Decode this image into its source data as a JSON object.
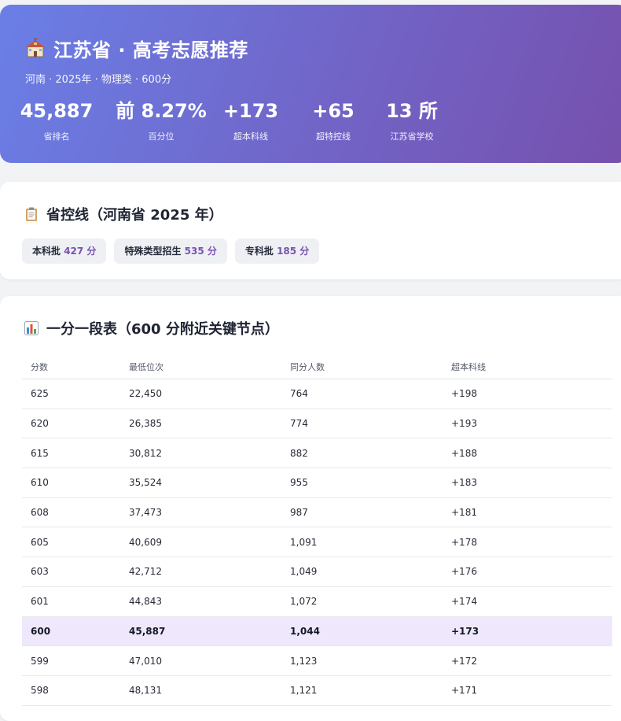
{
  "hero": {
    "title": "江苏省 · 高考志愿推荐",
    "subtitle": "河南 · 2025年 · 物理类 · 600分",
    "stats": [
      {
        "value": "45,887",
        "label": "省排名"
      },
      {
        "value": "前 8.27%",
        "label": "百分位"
      },
      {
        "value": "+173",
        "label": "超本科线"
      },
      {
        "value": "+65",
        "label": "超特控线"
      },
      {
        "value": "13 所",
        "label": "江苏省学校"
      }
    ]
  },
  "control_lines": {
    "title": "省控线（河南省 2025 年）",
    "items": [
      {
        "name": "本科批",
        "score": "427 分"
      },
      {
        "name": "特殊类型招生",
        "score": "535 分"
      },
      {
        "name": "专科批",
        "score": "185 分"
      }
    ]
  },
  "score_table": {
    "title": "一分一段表（600 分附近关键节点）",
    "headers": [
      "分数",
      "最低位次",
      "同分人数",
      "超本科线"
    ],
    "rows": [
      [
        "625",
        "22,450",
        "764",
        "+198"
      ],
      [
        "620",
        "26,385",
        "774",
        "+193"
      ],
      [
        "615",
        "30,812",
        "882",
        "+188"
      ],
      [
        "610",
        "35,524",
        "955",
        "+183"
      ],
      [
        "608",
        "37,473",
        "987",
        "+181"
      ],
      [
        "605",
        "40,609",
        "1,091",
        "+178"
      ],
      [
        "603",
        "42,712",
        "1,049",
        "+176"
      ],
      [
        "601",
        "44,843",
        "1,072",
        "+174"
      ],
      [
        "600",
        "45,887",
        "1,044",
        "+173"
      ],
      [
        "599",
        "47,010",
        "1,123",
        "+172"
      ],
      [
        "598",
        "48,131",
        "1,121",
        "+171"
      ]
    ],
    "highlight_score": "600"
  },
  "colors": {
    "hero_gradient_start": "#6a7fe6",
    "hero_gradient_end": "#7650ad",
    "accent": "#7a52b0",
    "highlight_row": "#efe8fd"
  }
}
